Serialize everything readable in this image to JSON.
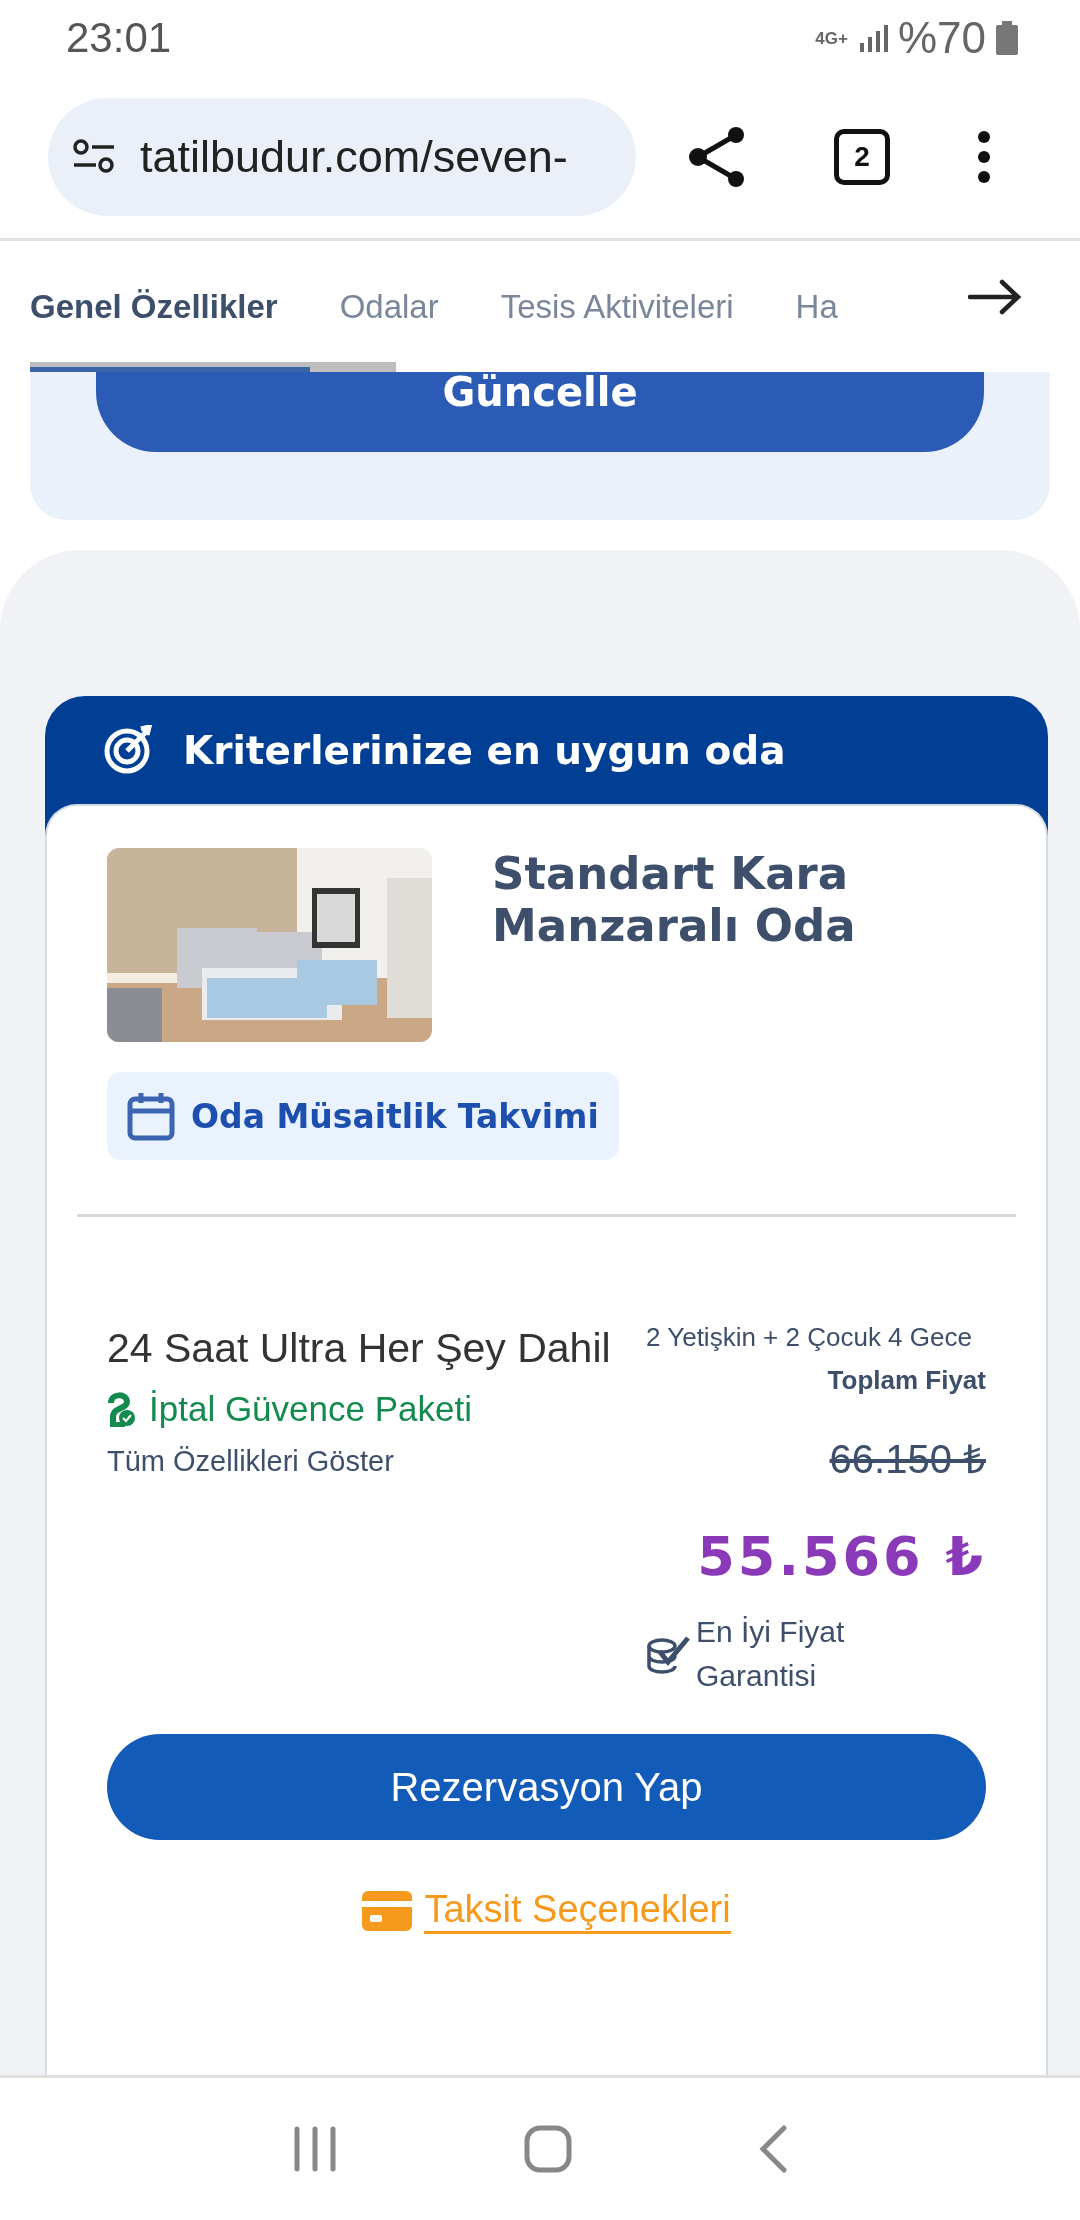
{
  "status_bar": {
    "time": "23:01",
    "network": "4G+",
    "battery": "%70"
  },
  "browser": {
    "url": "tatilbudur.com/seven-",
    "tab_count": "2"
  },
  "tabs": [
    {
      "label": "Genel Özellikler",
      "selected": true
    },
    {
      "label": "Odalar",
      "selected": false
    },
    {
      "label": "Tesis Aktiviteleri",
      "selected": false
    },
    {
      "label": "Ha",
      "selected": false
    }
  ],
  "update_button": "Güncelle",
  "room_card": {
    "header": "Kriterlerinize en uygun oda",
    "room_name": "Standart Kara Manzaralı Oda",
    "calendar_button": "Oda Müsaitlik Takvimi",
    "board": "24 Saat Ultra Her Şey Dahil",
    "insurance": "İptal Güvence Paketi",
    "features_link": "Tüm Özellikleri Göster",
    "guests": "2 Yetişkin + 2 Çocuk 4 Gece",
    "total_label": "Toplam Fiyat",
    "old_price": "66.150 ₺",
    "price": "55.566 ₺",
    "guarantee": "En İyi Fiyat Garantisi",
    "reserve_button": "Rezervasyon Yap",
    "installments_link": "Taksit Seçenekleri"
  }
}
